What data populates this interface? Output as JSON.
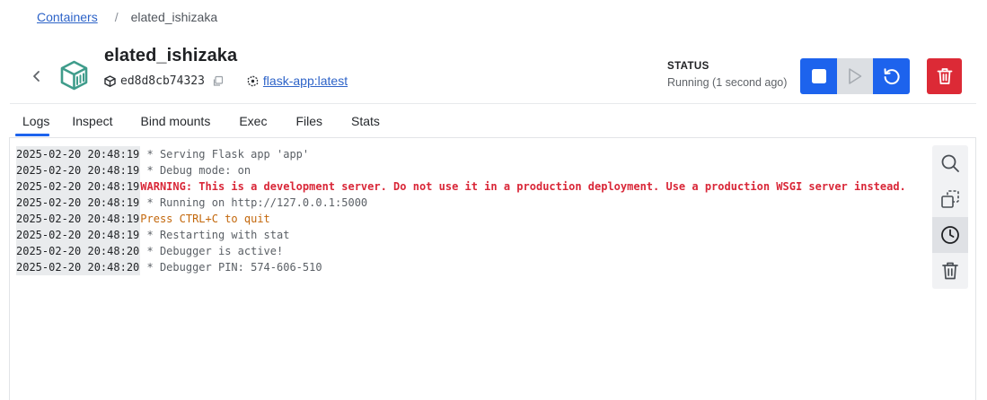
{
  "breadcrumb": {
    "parent": "Containers",
    "separator": "/",
    "current": "elated_ishizaka"
  },
  "container": {
    "name": "elated_ishizaka",
    "id": "ed8d8cb74323",
    "image": "flask-app:latest"
  },
  "status": {
    "label": "STATUS",
    "text": "Running (1 second ago)"
  },
  "tabs": [
    {
      "label": "Logs",
      "active": true
    },
    {
      "label": "Inspect"
    },
    {
      "label": "Bind mounts"
    },
    {
      "label": "Exec"
    },
    {
      "label": "Files"
    },
    {
      "label": "Stats"
    }
  ],
  "logs": [
    {
      "ts": "2025-02-20 20:48:19",
      "msg": " * Serving Flask app 'app'",
      "kind": "normal"
    },
    {
      "ts": "2025-02-20 20:48:19",
      "msg": " * Debug mode: on",
      "kind": "normal"
    },
    {
      "ts": "2025-02-20 20:48:19",
      "msg": "WARNING: This is a development server. Do not use it in a production deployment. Use a production WSGI server instead.",
      "kind": "warn"
    },
    {
      "ts": "2025-02-20 20:48:19",
      "msg": " * Running on http://127.0.0.1:5000",
      "kind": "normal"
    },
    {
      "ts": "2025-02-20 20:48:19",
      "msg": "Press CTRL+C to quit",
      "kind": "orange"
    },
    {
      "ts": "2025-02-20 20:48:19",
      "msg": " * Restarting with stat",
      "kind": "normal"
    },
    {
      "ts": "2025-02-20 20:48:20",
      "msg": " * Debugger is active!",
      "kind": "normal"
    },
    {
      "ts": "2025-02-20 20:48:20",
      "msg": " * Debugger PIN: 574-606-510",
      "kind": "normal"
    }
  ],
  "icons": {
    "back": "chevron-left-icon",
    "container": "container-box-icon",
    "id": "cube-icon",
    "copy": "copy-icon",
    "image": "image-layers-icon",
    "stop": "stop-icon",
    "start": "play-icon",
    "restart": "restart-icon",
    "delete": "trash-icon",
    "search": "search-icon",
    "copy_logs": "copy-icon",
    "timestamps": "clock-icon",
    "clear": "trash-icon"
  },
  "colors": {
    "accent": "#1d63ed",
    "danger": "#dc2a36",
    "container_icon": "#3f9c8b",
    "warning_text": "#d92738",
    "orange_text": "#c3670b"
  }
}
